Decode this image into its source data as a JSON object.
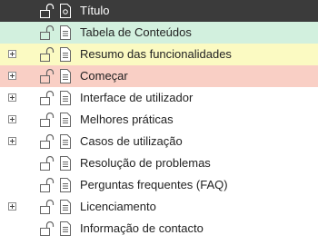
{
  "outline": {
    "header": {
      "label": "Título"
    },
    "items": [
      {
        "label": "Tabela de Conteúdos",
        "expandable": false
      },
      {
        "label": "Resumo das funcionalidades",
        "expandable": true
      },
      {
        "label": "Começar",
        "expandable": true
      },
      {
        "label": "Interface de utilizador",
        "expandable": true
      },
      {
        "label": "Melhores práticas",
        "expandable": true
      },
      {
        "label": "Casos de utilização",
        "expandable": true
      },
      {
        "label": "Resolução de problemas",
        "expandable": false
      },
      {
        "label": "Perguntas frequentes (FAQ)",
        "expandable": false
      },
      {
        "label": "Licenciamento",
        "expandable": true
      },
      {
        "label": "Informação de contacto",
        "expandable": false
      }
    ]
  },
  "colors": {
    "header_bg": "#3b3b3b",
    "toc_bg": "#d2f0de",
    "features_bg": "#fbfac2",
    "start_bg": "#f9cfc5"
  }
}
